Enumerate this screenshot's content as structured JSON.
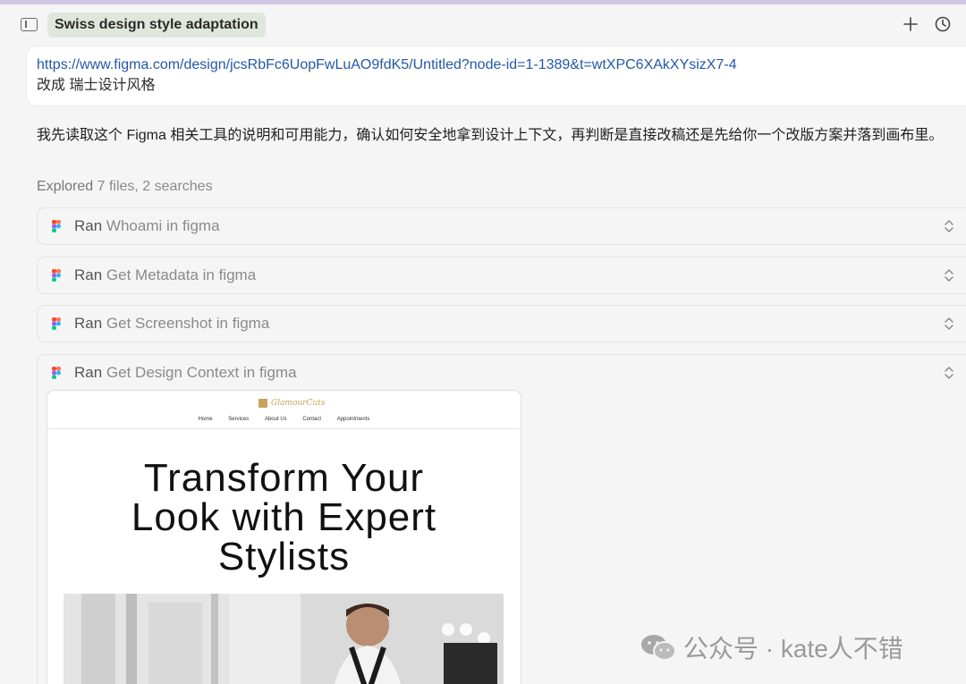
{
  "header": {
    "title": "Swiss design style adaptation",
    "icons": {
      "sidebar": "sidebar-toggle-icon",
      "new": "plus-icon",
      "history": "clock-icon"
    }
  },
  "prompt": {
    "link": "https://www.figma.com/design/jcsRbFc6UopFwLuAO9fdK5/Untitled?node-id=1-1389&t=wtXPC6XAkXYsizX7-4",
    "text": "改成 瑞士设计风格"
  },
  "reply": {
    "text": "我先读取这个 Figma 相关工具的说明和可用能力，确认如何安全地拿到设计上下文，再判断是直接改稿还是先给你一个改版方案并落到画布里。",
    "explored_label": "Explored",
    "explored_detail": "7 files, 2 searches"
  },
  "tool_calls": [
    {
      "ran": "Ran",
      "name": "Whoami in figma"
    },
    {
      "ran": "Ran",
      "name": "Get Metadata in figma"
    },
    {
      "ran": "Ran",
      "name": "Get Screenshot in figma"
    },
    {
      "ran": "Ran",
      "name": "Get Design Context in figma"
    }
  ],
  "preview": {
    "logo": "GlamourCuts",
    "nav": [
      "Home",
      "Services",
      "About Us",
      "Contact",
      "Appointments"
    ],
    "headline_1": "Transform Your",
    "headline_2": "Look with Expert",
    "headline_3": "Stylists"
  },
  "watermark": "公众号 · kate人不错",
  "colors": {
    "accent": "#cfc6e3",
    "title_chip": "#dfe7dc",
    "link": "#2457a8",
    "brand_gold": "#c9a35b"
  }
}
